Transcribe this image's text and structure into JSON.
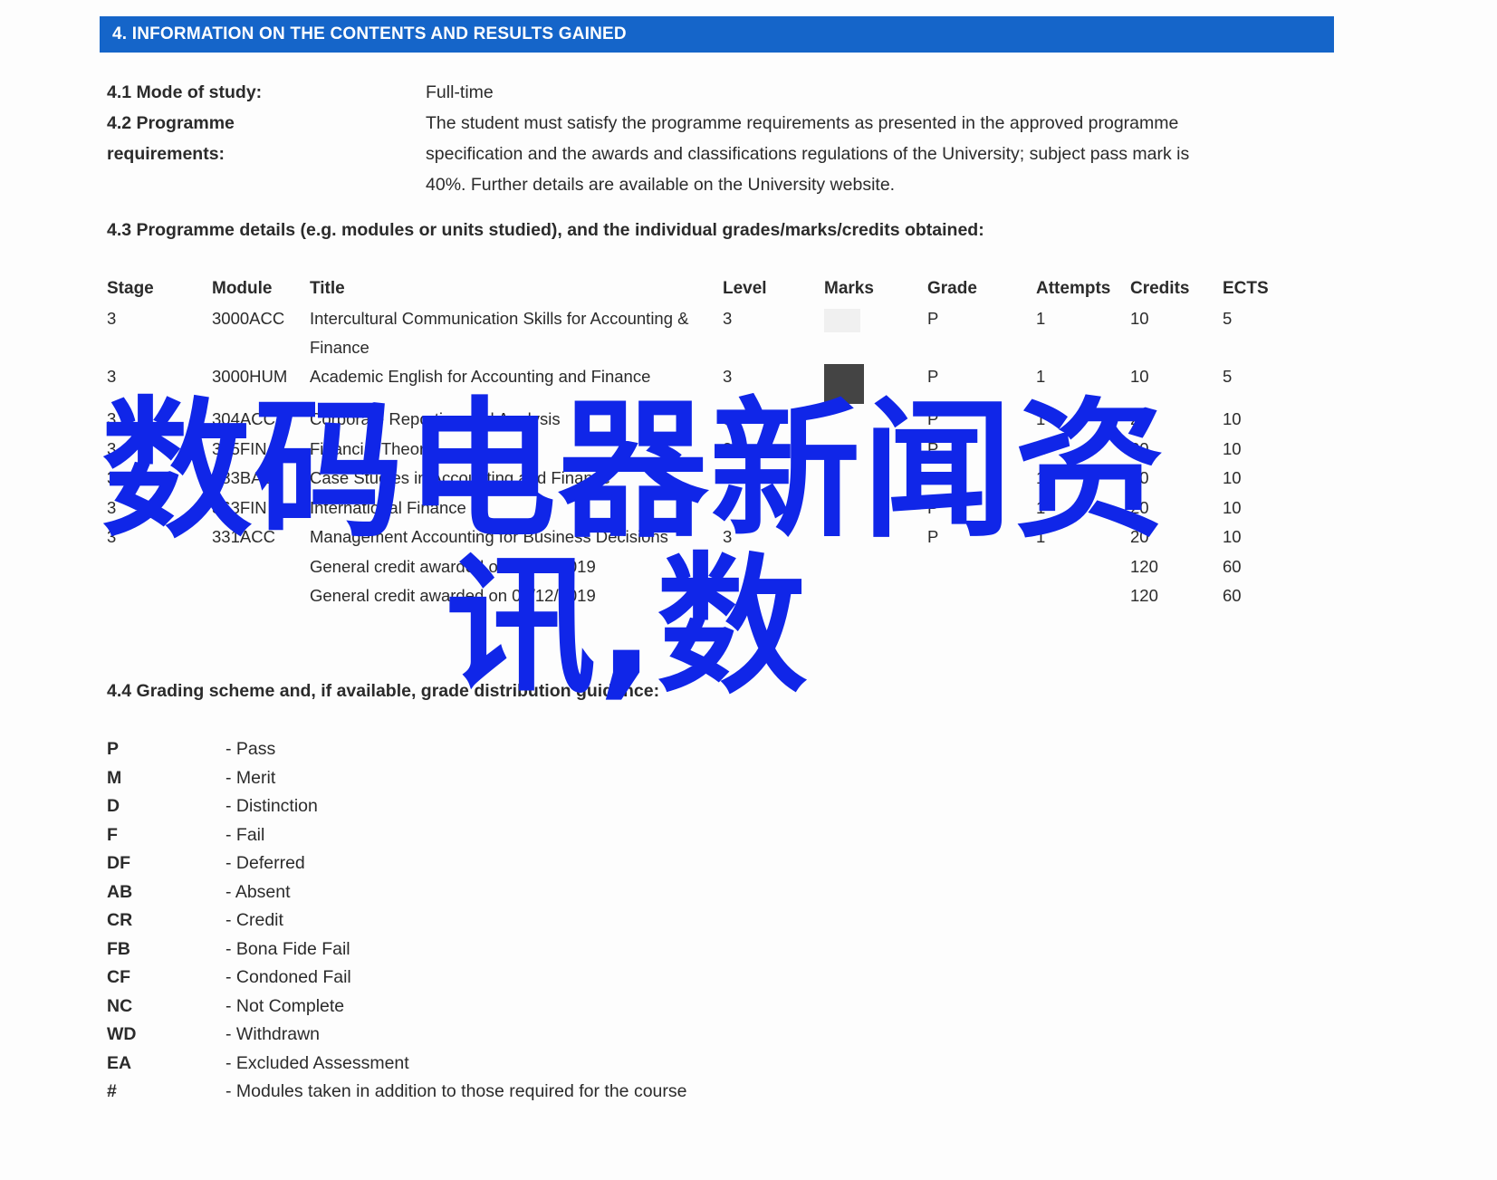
{
  "document": {
    "section_banner": "4. INFORMATION ON THE CONTENTS AND RESULTS GAINED",
    "accent_color": "#1565c9",
    "watermark_color": "#1026e8"
  },
  "fields": {
    "mode_of_study": {
      "label": "4.1 Mode of study:",
      "value": "Full-time"
    },
    "programme_requirements": {
      "label_line1": "4.2 Programme",
      "label_line2": "requirements:",
      "value_line1": "The student must satisfy the programme requirements as presented in the approved programme",
      "value_line2": "specification and the awards and classifications regulations of the University; subject pass mark is",
      "value_line3": "40%. Further details are available on the University website."
    }
  },
  "headings": {
    "programme_details": "4.3 Programme details (e.g. modules or units studied), and the individual grades/marks/credits obtained:",
    "grading_scheme": "4.4 Grading scheme and, if available, grade distribution guidance:"
  },
  "modules_table": {
    "columns": [
      "Stage",
      "Module",
      "Title",
      "Level",
      "Marks",
      "Grade",
      "Attempts",
      "Credits",
      "ECTS"
    ],
    "rows": [
      {
        "stage": "3",
        "module": "3000ACC",
        "title": "Intercultural Communication Skills for Accounting & Finance",
        "level": "3",
        "marks": "",
        "grade": "P",
        "attempts": "1",
        "credits": "10",
        "ects": "5",
        "marks_redacted": "faint"
      },
      {
        "stage": "3",
        "module": "3000HUM",
        "title": "Academic English for Accounting and Finance",
        "level": "3",
        "marks": "",
        "grade": "P",
        "attempts": "1",
        "credits": "10",
        "ects": "5",
        "marks_redacted": "solid"
      },
      {
        "stage": "3",
        "module": "304ACC",
        "title": "Corporate Reporting and Analysis",
        "level": "3",
        "marks": "",
        "grade": "P",
        "attempts": "1",
        "credits": "20",
        "ects": "10",
        "marks_redacted": "none"
      },
      {
        "stage": "3",
        "module": "305FIN",
        "title": "Financial Theory",
        "level": "3",
        "marks": "",
        "grade": "P",
        "attempts": "1",
        "credits": "20",
        "ects": "10",
        "marks_redacted": "none"
      },
      {
        "stage": "3",
        "module": "383BAC",
        "title": "Case Studies in Accounting and Finance",
        "level": "3",
        "marks": "",
        "grade": "P",
        "attempts": "1",
        "credits": "20",
        "ects": "10",
        "marks_redacted": "none"
      },
      {
        "stage": "3",
        "module": "363FIN",
        "title": "International Finance",
        "level": "3",
        "marks": "",
        "grade": "P",
        "attempts": "1",
        "credits": "20",
        "ects": "10",
        "marks_redacted": "none"
      },
      {
        "stage": "3",
        "module": "331ACC",
        "title": "Management Accounting for Business Decisions",
        "level": "3",
        "marks": "",
        "grade": "P",
        "attempts": "1",
        "credits": "20",
        "ects": "10",
        "marks_redacted": "none"
      },
      {
        "stage": "",
        "module": "",
        "title": "General credit awarded on 01/12/2019",
        "level": "",
        "marks": "",
        "grade": "",
        "attempts": "",
        "credits": "120",
        "ects": "60",
        "marks_redacted": "none"
      },
      {
        "stage": "",
        "module": "",
        "title": "General credit awarded on 01/12/2019",
        "level": "",
        "marks": "",
        "grade": "",
        "attempts": "",
        "credits": "120",
        "ects": "60",
        "marks_redacted": "none"
      }
    ]
  },
  "grading_legend": [
    {
      "code": "P",
      "desc": "- Pass"
    },
    {
      "code": "M",
      "desc": "- Merit"
    },
    {
      "code": "D",
      "desc": "- Distinction"
    },
    {
      "code": "F",
      "desc": "- Fail"
    },
    {
      "code": "DF",
      "desc": "- Deferred"
    },
    {
      "code": "AB",
      "desc": "- Absent"
    },
    {
      "code": "CR",
      "desc": "- Credit"
    },
    {
      "code": "FB",
      "desc": "- Bona Fide Fail"
    },
    {
      "code": "CF",
      "desc": "- Condoned Fail"
    },
    {
      "code": "NC",
      "desc": "- Not Complete"
    },
    {
      "code": "WD",
      "desc": "- Withdrawn"
    },
    {
      "code": "EA",
      "desc": "- Excluded Assessment"
    },
    {
      "code": "#",
      "desc": "- Modules taken in addition to those required for the course"
    }
  ],
  "watermark": {
    "line1": "数码电器新闻资",
    "line2": "讯,数"
  }
}
